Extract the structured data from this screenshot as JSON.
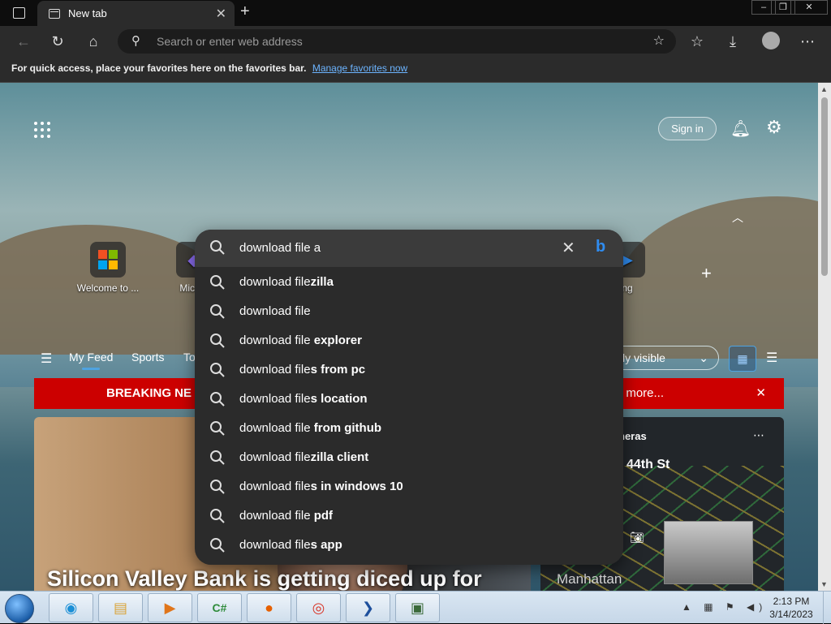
{
  "browser": {
    "tab_title": "New tab",
    "address_placeholder": "Search or enter web address",
    "favbar_text": "For quick access, place your favorites here on the favorites bar.",
    "favbar_link": "Manage favorites now"
  },
  "newtab": {
    "sign_in": "Sign in",
    "quick_links": [
      {
        "label": "Welcome to ..."
      },
      {
        "label": "Micros"
      },
      {
        "label": "ng"
      }
    ],
    "feed_tabs": [
      "My Feed",
      "Sports",
      "To"
    ],
    "visibility": "ly visible",
    "breaking_left": "BREAKING NE",
    "breaking_right": "k for more...",
    "headline": "Silicon Valley Bank is getting diced up for",
    "traffic_label": "neras",
    "traffic_street": "44th St",
    "traffic_city": "Manhattan"
  },
  "search": {
    "query": "download file a",
    "suggestions": [
      {
        "prefix": "download file",
        "bold": "zilla"
      },
      {
        "prefix": "download file",
        "bold": ""
      },
      {
        "prefix": "download file",
        "bold": " explorer"
      },
      {
        "prefix": "download file",
        "bold": "s from pc"
      },
      {
        "prefix": "download file",
        "bold": "s location"
      },
      {
        "prefix": "download file",
        "bold": " from github"
      },
      {
        "prefix": "download file",
        "bold": "zilla client"
      },
      {
        "prefix": "download file",
        "bold": "s in windows 10"
      },
      {
        "prefix": "download file",
        "bold": " pdf"
      },
      {
        "prefix": "download file",
        "bold": "s app"
      }
    ]
  },
  "taskbar": {
    "apps": [
      "edge-icon",
      "file-explorer-icon",
      "media-player-icon",
      "csharp-icon",
      "firefox-icon",
      "chrome-icon",
      "powershell-icon",
      "terminal-icon"
    ],
    "time": "2:13 PM",
    "date": "3/14/2023"
  },
  "colors": {
    "accent": "#2f8cf0",
    "breaking": "#cc0000",
    "panel": "#2b2b2b"
  }
}
